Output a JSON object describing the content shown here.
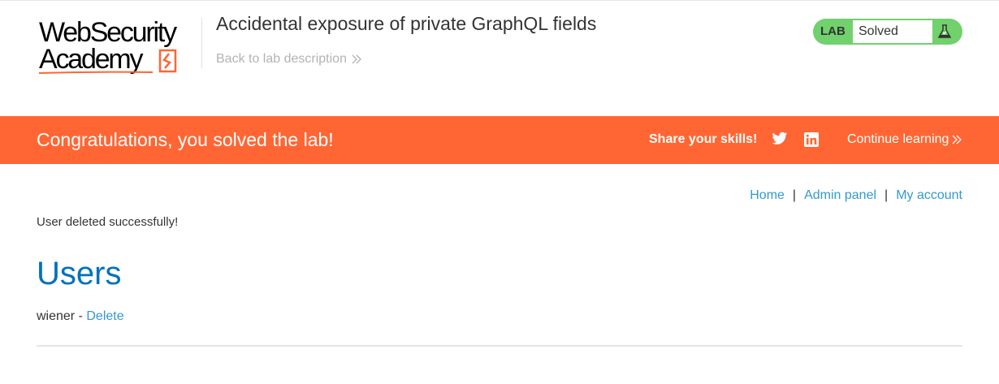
{
  "header": {
    "logo_line1": "WebSecurity",
    "logo_line2": "Academy",
    "lab_title": "Accidental exposure of private GraphQL fields",
    "back_link": "Back to lab description",
    "lab_badge": "LAB",
    "lab_status": "Solved"
  },
  "banner": {
    "congrats": "Congratulations, you solved the lab!",
    "share": "Share your skills!",
    "continue": "Continue learning",
    "icons": [
      "twitter-icon",
      "linkedin-icon"
    ]
  },
  "nav": {
    "home": "Home",
    "separator": "|",
    "admin": "Admin panel",
    "account": "My account"
  },
  "main": {
    "message": "User deleted successfully!",
    "heading": "Users",
    "users": [
      {
        "name": "wiener",
        "separator": " - ",
        "action": "Delete"
      }
    ]
  },
  "colors": {
    "accent": "#ff6633",
    "link": "#3399cc",
    "heading": "#0071bc",
    "solved": "#70d16d"
  }
}
